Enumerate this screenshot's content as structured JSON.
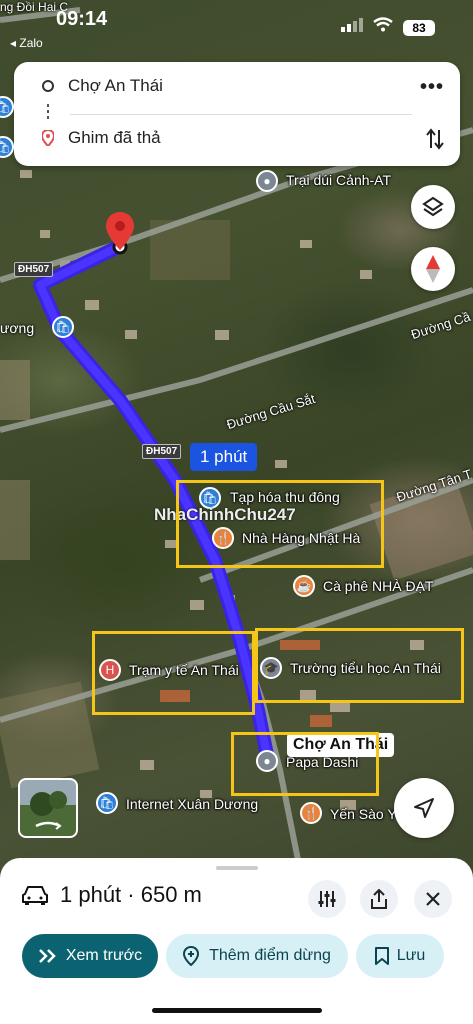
{
  "status_bar": {
    "time": "09:14",
    "back_app": "Zalo",
    "battery": "83"
  },
  "route": {
    "origin": "Chợ An Thái",
    "destination": "Ghim đã thả"
  },
  "map": {
    "roads": [
      "ĐH507",
      "ĐH507",
      "Đường Cầu Sắt",
      "Đường Cầ",
      "Đường Tân T",
      "ương",
      "ng Đồi Hai C"
    ],
    "places": [
      {
        "name": "Trại dúi Cảnh-AT",
        "icon": "pin-icon"
      },
      {
        "name": "Tạp hóa thu đông",
        "icon": "shopping-icon"
      },
      {
        "name": "Nhà Hàng Nhật Hà",
        "icon": "restaurant-icon"
      },
      {
        "name": "Cà phê NHÀ ĐẠT",
        "icon": "coffee-icon"
      },
      {
        "name": "Trạm y tế An Thái",
        "icon": "hospital-icon"
      },
      {
        "name": "Trường tiểu học An Thái",
        "icon": "school-icon"
      },
      {
        "name": "Papa Dashi",
        "icon": "pin-icon"
      },
      {
        "name": "Internet Xuân Dương",
        "icon": "shopping-icon"
      },
      {
        "name": "Yến Sào Y",
        "icon": "restaurant-icon"
      }
    ],
    "duration_badge": "1 phút",
    "destination_label": "Chợ An Thái",
    "watermark": "NhaChinhChu247",
    "route_color": "#3b23e6",
    "highlight_color": "#f5c518"
  },
  "sheet": {
    "summary": "1 phút · 650 m",
    "preview_label": "Xem trước",
    "add_stop_label": "Thêm điểm dừng",
    "save_label": "Lưu"
  }
}
